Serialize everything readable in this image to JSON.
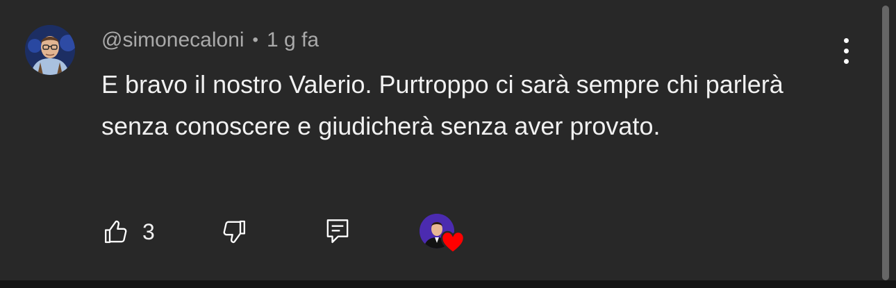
{
  "comment": {
    "author": "@simonecaloni",
    "separator": "•",
    "time": "1 g fa",
    "text": "E bravo il nostro Valerio. Purtroppo ci sarà sempre chi parlerà senza conoscere e giudicherà senza aver provato."
  },
  "actions": {
    "like_count": "3",
    "like_icon": "thumbs-up-icon",
    "dislike_icon": "thumbs-down-icon",
    "reply_icon": "reply-comment-icon",
    "hearted_icon": "heart-icon"
  },
  "menu": {
    "icon": "more-vertical-icon"
  },
  "colors": {
    "background": "#282828",
    "meta_text": "#aaaaaa",
    "body_text": "#f1f1f1",
    "heart": "#ff0000",
    "creator_avatar_bg": "#4a2aa8"
  }
}
